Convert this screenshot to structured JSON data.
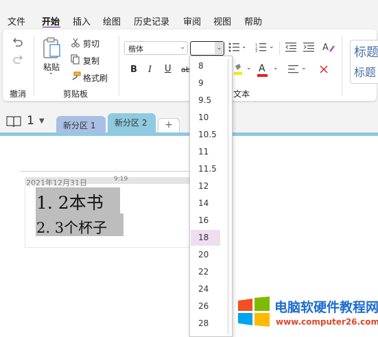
{
  "menu": {
    "items": [
      "文件",
      "开始",
      "插入",
      "绘图",
      "历史记录",
      "审阅",
      "视图",
      "帮助"
    ],
    "active_index": 1
  },
  "ribbon": {
    "undo_group_label": "撤消",
    "clipboard": {
      "paste": "粘贴",
      "cut": "剪切",
      "copy": "复制",
      "format_painter": "格式刷",
      "group_label": "剪贴板"
    },
    "font": {
      "name": "楷体",
      "size": "",
      "bold": "B",
      "italic": "I",
      "underline": "U",
      "strike": "ab",
      "font_color_letter": "A",
      "highlight_color": "#ffe600",
      "font_color": "#e0202a",
      "group_label_partial": "文本"
    },
    "styles": {
      "style1": "标题",
      "style2": "标题"
    }
  },
  "notebook": {
    "name": "1",
    "sections": [
      "新分区 1",
      "新分区 2"
    ],
    "active_section": 1,
    "add_section_label": "+"
  },
  "page": {
    "date": "2021年12月31日",
    "time": "9:19",
    "lines": [
      "1. 2本书",
      "2. 3个杯子"
    ]
  },
  "font_size_dropdown": {
    "options": [
      "8",
      "9",
      "9.5",
      "10",
      "10.5",
      "11",
      "11.5",
      "12",
      "14",
      "16",
      "18",
      "20",
      "22",
      "24",
      "26",
      "28"
    ],
    "highlighted": "18"
  },
  "watermark": {
    "title": "电脑软硬件教程网",
    "url": "www.computer26.com"
  }
}
